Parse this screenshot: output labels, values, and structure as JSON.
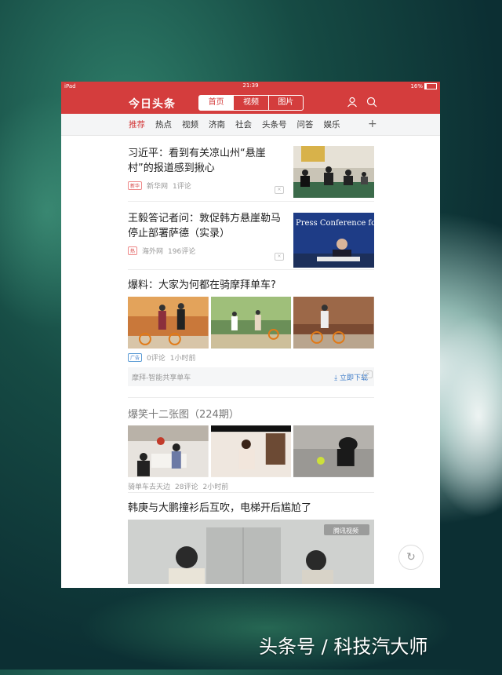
{
  "status": {
    "left": "iPad",
    "time": "21:39",
    "battery": "16%"
  },
  "app": {
    "logo": "今日头条",
    "segments": [
      "首页",
      "视频",
      "图片"
    ]
  },
  "tabs": [
    "推荐",
    "热点",
    "视频",
    "济南",
    "社会",
    "头条号",
    "问答",
    "娱乐"
  ],
  "feed": {
    "item1": {
      "title": "习近平：看到有关凉山州“悬崖村”的报道感到揪心",
      "tag": "新华",
      "source": "新华网",
      "comments": "1评论"
    },
    "item2": {
      "title": "王毅答记者问：敦促韩方悬崖勒马停止部署萨德（实录）",
      "tag": "热",
      "source": "海外网",
      "comments": "196评论"
    },
    "item3": {
      "title": "爆料：大家为何都在骑摩拜单车?",
      "tag": "广告",
      "comments": "0评论",
      "time": "1小时前",
      "adname": "摩拜-智能共享单车",
      "download": "立即下载"
    },
    "item4": {
      "title": "爆笑十二张图（224期）",
      "source": "骑单车去天边",
      "comments": "28评论",
      "time": "2小时前"
    },
    "item5": {
      "title": "韩庚与大鹏撞衫后互吹，电梯开后尴尬了",
      "video_badge": "腾讯视频"
    },
    "press_text": "Press Conference for"
  },
  "watermark": "头条号 / 科技汽大师"
}
